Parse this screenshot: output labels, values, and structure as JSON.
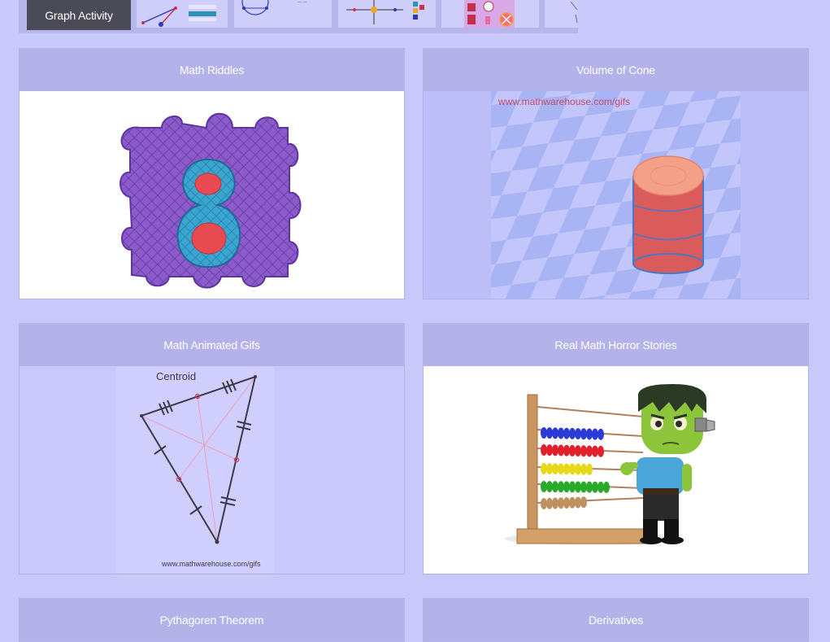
{
  "thumbnail_strip": {
    "active_label": "Graph Activity"
  },
  "cards": [
    {
      "title": "Math Riddles"
    },
    {
      "title": "Volume of Cone",
      "watermark": "www.mathwarehouse.com/gifs"
    },
    {
      "title": "Math Animated Gifs",
      "figure_label": "Centroid",
      "watermark": "www.mathwarehouse.com/gifs"
    },
    {
      "title": "Real Math Horror Stories"
    },
    {
      "title": "Pythagoren Theorem"
    },
    {
      "title": "Derivatives"
    }
  ],
  "colors": {
    "page_background": "#c9c8fb",
    "card_header": "#b3b2e9",
    "active_thumbnail": "#4b4a57"
  }
}
